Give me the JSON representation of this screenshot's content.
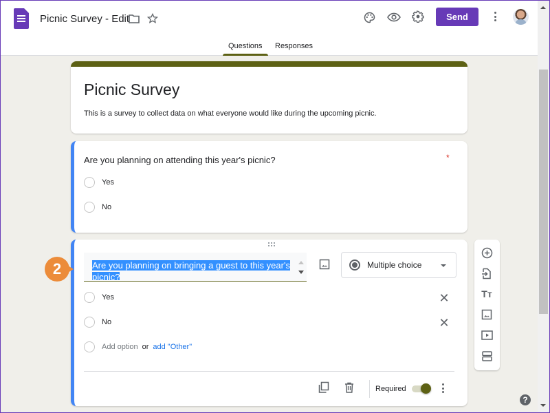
{
  "header": {
    "doc_title": "Picnic Survey - Edit",
    "send_label": "Send",
    "icons": [
      "forms-logo-icon",
      "folder-icon",
      "star-icon",
      "palette-icon",
      "preview-eye-icon",
      "settings-gear-icon",
      "more-vert-icon",
      "avatar"
    ]
  },
  "tabs": [
    {
      "label": "Questions",
      "active": true
    },
    {
      "label": "Responses",
      "active": false
    }
  ],
  "theme": {
    "accent": "#5d6114",
    "brand": "#673ab7",
    "question_highlight": "#4285f4",
    "callout": "#ec8c3a"
  },
  "form": {
    "title": "Picnic Survey",
    "description": "This is a survey to collect data on what everyone would like during the upcoming picnic."
  },
  "questions": [
    {
      "title": "Are you planning on attending this year's picnic?",
      "required_marker": "*",
      "options": [
        "Yes",
        "No"
      ]
    },
    {
      "title": "Are you planning on bringing a guest to this year's picnic?",
      "type": "Multiple choice",
      "options": [
        "Yes",
        "No"
      ],
      "add_option_label": "Add option",
      "or_label": "or",
      "add_other_label": "add \"Other\"",
      "required_label": "Required",
      "required_on": true
    }
  ],
  "side_toolbar": [
    "add-question-icon",
    "import-questions-icon",
    "add-title-icon",
    "add-image-icon",
    "add-video-icon",
    "add-section-icon"
  ],
  "callout": {
    "number": "2"
  },
  "help": {
    "label": "?"
  }
}
